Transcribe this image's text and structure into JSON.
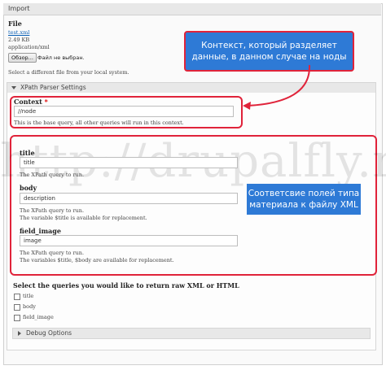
{
  "import": {
    "legend": "Import",
    "file_label": "File",
    "file_name": "test.xml",
    "file_size": "2.49 KB",
    "file_mime": "application/xml",
    "browse_button": "Обзор...",
    "no_file_text": "Файл не выбран.",
    "file_hint": "Select a different file from your local system."
  },
  "xpath_parser": {
    "header": "XPath Parser Settings",
    "context": {
      "label": "Context",
      "required_mark": "*",
      "value": "//node",
      "hint": "This is the base query, all other queries will run in this context."
    },
    "fields": [
      {
        "label": "title",
        "value": "title",
        "hint1": "The XPath query to run.",
        "hint2": ""
      },
      {
        "label": "body",
        "value": "description",
        "hint1": "The XPath query to run.",
        "hint2": "The variable $title is available for replacement."
      },
      {
        "label": "field_image",
        "value": "image",
        "hint1": "The XPath query to run.",
        "hint2": "The variables $title, $body are available for replacement."
      }
    ],
    "raw_label": "Select the queries you would like to return raw XML or HTML",
    "raw_options": [
      "title",
      "body",
      "field_image"
    ],
    "debug_header": "Debug Options"
  },
  "annotations": {
    "callout_top": "Контекст, который разделяет данные, в данном случае на ноды",
    "callout_right": "Соответсвие полей типа материала к файлу XML",
    "watermark": "http://drupalfly.ru"
  },
  "colors": {
    "callout_bg": "#2e7ad6",
    "highlight_red": "#e0233a",
    "link": "#0a5fb4"
  }
}
